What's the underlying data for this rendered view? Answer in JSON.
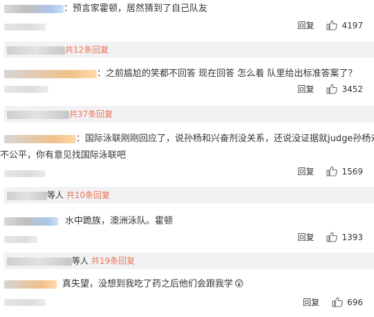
{
  "reply_label": "回复",
  "comments": [
    {
      "text": "：预言家霍顿，居然猜到了自己队友",
      "likes": "4197"
    },
    {
      "text": "：之前尴尬的笑都不回答 现在回答 怎么着 队里给出标准答案了？",
      "likes": "3452"
    },
    {
      "text_line1": "：国际泳联刚刚回应了，说孙杨和兴奋剂没关系，还说没证据就judge孙杨对他",
      "text_line2": "不公平，你有意见找国际泳联吧",
      "likes": "1569"
    },
    {
      "text": "水中跪族，澳洲泳队。霍顿",
      "likes": "1393"
    },
    {
      "text": "真失望，没想到我吃了药之后他们会跟我学",
      "emoji": "😲",
      "likes": "696"
    }
  ],
  "sub_replies": [
    {
      "who": "",
      "link": "共12条回复"
    },
    {
      "who": "",
      "link": "共37条回复"
    },
    {
      "who": "等人",
      "link": "共10条回复"
    },
    {
      "who": "等人",
      "link": "共19条回复"
    }
  ]
}
